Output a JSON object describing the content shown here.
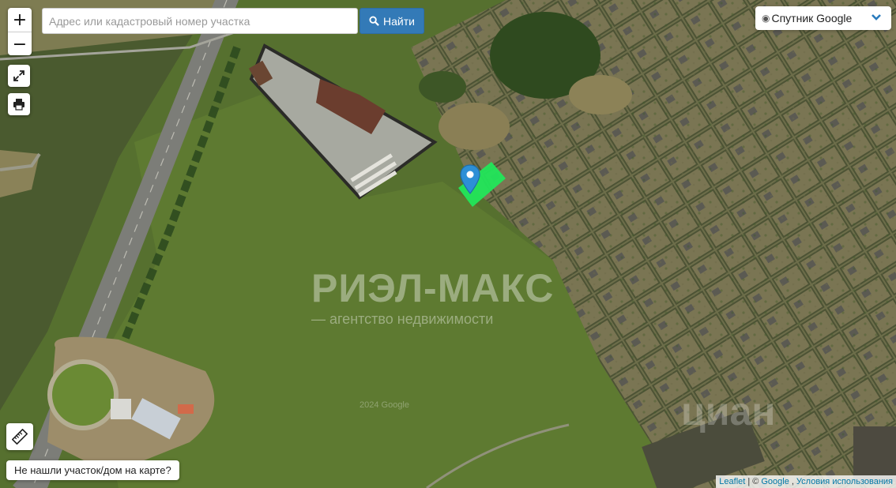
{
  "search": {
    "placeholder": "Адрес или кадастровый номер участка",
    "button_label": "Найти"
  },
  "zoom": {
    "in_label": "+",
    "out_label": "−"
  },
  "layer_select": {
    "selected": "Спутник Google"
  },
  "not_found_button": "Не нашли участок/дом на карте?",
  "attribution": {
    "leaflet": "Leaflet",
    "separator": "| ©",
    "google": "Google",
    "terms": "Условия использования"
  },
  "watermark": {
    "title": "РИЭЛ-МАКС",
    "subtitle": "— агентство недвижимости",
    "cian": "циан",
    "google_tiles": "2024 Google"
  },
  "colors": {
    "plot_polygon": "#22e65a",
    "marker": "#2d8fd6",
    "search_button": "#337ab7"
  },
  "icons": {
    "search": "magnifier-icon",
    "fullscreen": "expand-icon",
    "print": "printer-icon",
    "ruler": "ruler-icon",
    "layer_chevron": "chevron-down-icon",
    "marker": "map-pin-icon"
  }
}
